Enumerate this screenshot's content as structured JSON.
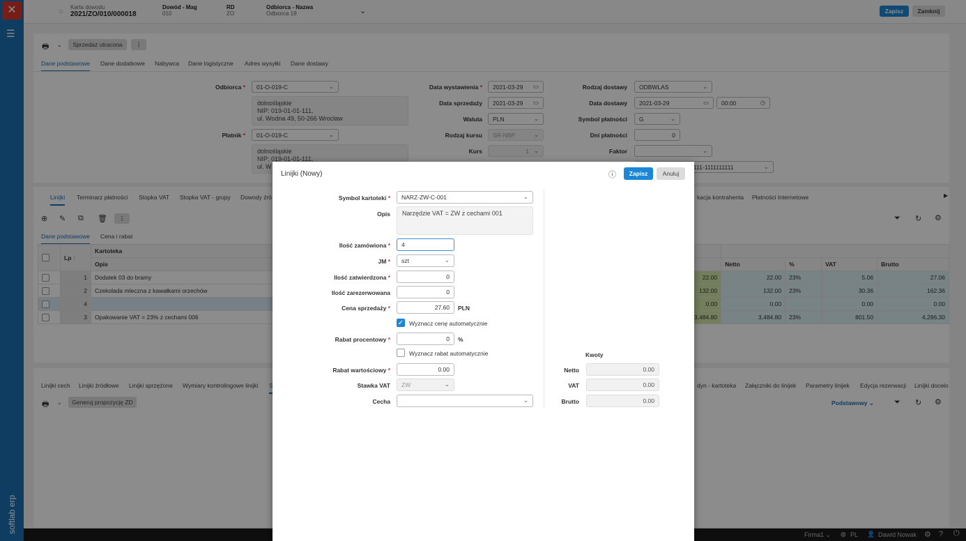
{
  "app": {
    "brand": "softlab erp"
  },
  "header": {
    "doc_label": "Karta dowodu",
    "doc_value": "2021/ZO/010/000018",
    "mag_label": "Dowód - Mag",
    "mag_value": "010",
    "rd_label": "RD",
    "rd_value": "ZO",
    "odb_label": "Odbiorca - Nazwa",
    "odb_value": "Odbiorca 19",
    "save": "Zapisz",
    "close": "Zamknij"
  },
  "top_panel": {
    "lost_sale": "Sprzedaż utracona",
    "tabs": [
      "Dane podstawowe",
      "Dane dodatkowe",
      "Nabywca",
      "Dane logistyczne",
      "Adres wysyłki",
      "Dane dostawy"
    ],
    "odbiorca_label": "Odbiorca",
    "odbiorca": "01-O-019-C",
    "odbiorca_addr": [
      "dolnośląskie",
      "NIP: 019-01-01-111,",
      "ul. Wodna 49, 50-266 Wrocław"
    ],
    "platnik_label": "Płatnik",
    "platnik": "01-O-019-C",
    "platnik_addr": [
      "dolnośląskie",
      "NIP: 019-01-01-111,",
      "ul. W"
    ],
    "data_wyst_label": "Data wystawienia",
    "data_wyst": "2021-03-29",
    "data_sprz_label": "Data sprzedaży",
    "data_sprz": "2021-03-29",
    "waluta_label": "Waluta",
    "waluta": "PLN",
    "rodzaj_kursu_label": "Rodzaj kursu",
    "rodzaj_kursu": "SR-NBP",
    "kurs_label": "Kurs",
    "kurs": "1",
    "rodzaj_dost_label": "Rodzaj dostawy",
    "rodzaj_dost": "ODBWLAS",
    "data_dost_label": "Data dostawy",
    "data_dost": "2021-03-29",
    "time_dost": "00:00",
    "symbol_plat_label": "Symbol płatności",
    "symbol_plat": "G",
    "dni_plat_label": "Dni płatności",
    "dni_plat": "0",
    "faktor_label": "Faktor",
    "faktor": "",
    "account": "1111-1111111111"
  },
  "lines_panel": {
    "tabs": [
      "Linijki",
      "Terminarz płatności",
      "Stopka VAT",
      "Stopka VAT - grupy",
      "Dowody źró",
      "kacja kontrahenta",
      "Płatności Internetowe"
    ],
    "subtabs": [
      "Dane podstawowe",
      "Cena i rabat"
    ],
    "columns": {
      "lp": "Lp",
      "kartoteka": "Kartoteka",
      "opis": "Opis",
      "netto": "Netto",
      "pct": "%",
      "vat": "VAT",
      "brutto": "Brutto"
    },
    "rows": [
      {
        "lp": "1",
        "opis": "Dodatek 03 do bramy",
        "val": "22.00",
        "netto": "22.00",
        "pct": "23%",
        "vat": "5.06",
        "brutto": "27.06"
      },
      {
        "lp": "2",
        "opis": "Czekolada mleczna z kawałkami orzechów",
        "val": "132.00",
        "netto": "132.00",
        "pct": "23%",
        "vat": "30.36",
        "brutto": "162.36"
      },
      {
        "lp": "4",
        "opis": "",
        "val": "0.00",
        "netto": "0.00",
        "pct": "",
        "vat": "0.00",
        "brutto": "0.00"
      },
      {
        "lp": "3",
        "opis": "Opakowanie VAT = 23% z cechami 006",
        "val": "3,484.80",
        "netto": "3,484.80",
        "pct": "23%",
        "vat": "801.50",
        "brutto": "4,286.30"
      }
    ]
  },
  "bottom_panel": {
    "tabs": [
      "Linijki cech",
      "Linijki źródłowe",
      "Linijki sprzężone",
      "Wymiary kontrolingowe linijki",
      "S",
      "dyn - kartoteka",
      "Załączniki do linijek",
      "Parametry linijek",
      "Edycja rezerwacji",
      "Linijki docelo"
    ],
    "generate": "Generuj propozycję ZD",
    "view": "Podstawowy"
  },
  "statusbar": {
    "company": "Firma1",
    "lang": "PL",
    "user": "Dawid Nowak"
  },
  "modal": {
    "title": "Linijki (Nowy)",
    "save": "Zapisz",
    "cancel": "Anuluj",
    "symbol_label": "Symbol kartoteki",
    "symbol": "NARZ-ZW-C-001",
    "opis_label": "Opis",
    "opis": "Narzędzie VAT = ZW z cechami 001",
    "ilosc_zam_label": "Ilość zamówiona",
    "ilosc_zam": "4",
    "jm_label": "JM",
    "jm": "szt",
    "ilosc_zatw_label": "Ilość zatwierdzona",
    "ilosc_zatw": "0",
    "ilosc_zarez_label": "Ilość zarezerwowana",
    "ilosc_zarez": "0",
    "cena_label": "Cena sprzedaży",
    "cena": "27.60",
    "currency": "PLN",
    "auto_price_label": "Wyznacz cenę automatycznie",
    "auto_price": true,
    "rabat_pct_label": "Rabat procentowy",
    "rabat_pct": "0",
    "pct_unit": "%",
    "auto_rabat_label": "Wyznacz rabat automatycznie",
    "auto_rabat": false,
    "rabat_wart_label": "Rabat wartościowy",
    "rabat_wart": "0.00",
    "stawka_label": "Stawka VAT",
    "stawka": "ZW",
    "cecha_label": "Cecha",
    "cecha": "",
    "kwoty_label": "Kwoty",
    "netto_label": "Netto",
    "netto": "0.00",
    "vat_label": "VAT",
    "vat": "0.00",
    "brutto_label": "Brutto",
    "brutto": "0.00"
  }
}
